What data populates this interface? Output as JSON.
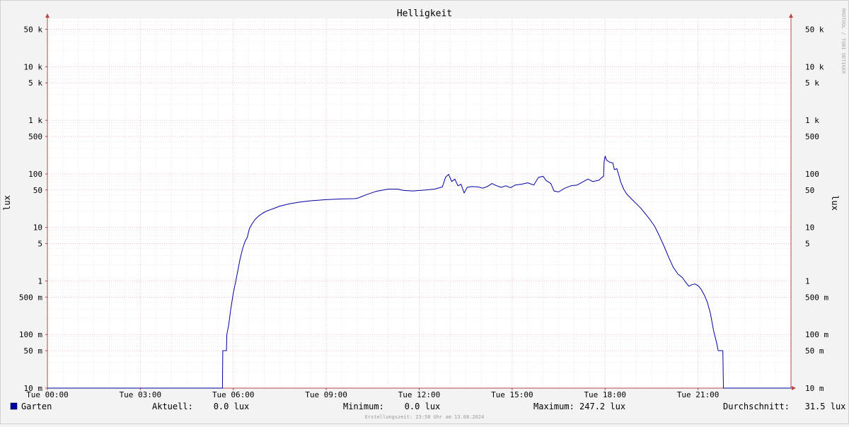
{
  "chart_data": {
    "type": "line",
    "title": "Helligkeit",
    "ylabel": "lux",
    "ylabel_right": "lux",
    "y_scale": "log",
    "ylim": [
      0.01,
      80000
    ],
    "x_range_hours": [
      0,
      24
    ],
    "x_ticks": [
      {
        "label": "Tue 00:00",
        "hour": 0
      },
      {
        "label": "Tue 03:00",
        "hour": 3
      },
      {
        "label": "Tue 06:00",
        "hour": 6
      },
      {
        "label": "Tue 09:00",
        "hour": 9
      },
      {
        "label": "Tue 12:00",
        "hour": 12
      },
      {
        "label": "Tue 15:00",
        "hour": 15
      },
      {
        "label": "Tue 18:00",
        "hour": 18
      },
      {
        "label": "Tue 21:00",
        "hour": 21
      }
    ],
    "y_ticks": [
      {
        "label": "50 k",
        "value": 50000
      },
      {
        "label": "10 k",
        "value": 10000
      },
      {
        "label": "5 k",
        "value": 5000
      },
      {
        "label": "1 k",
        "value": 1000
      },
      {
        "label": "500",
        "value": 500
      },
      {
        "label": "100",
        "value": 100
      },
      {
        "label": "50",
        "value": 50
      },
      {
        "label": "10",
        "value": 10
      },
      {
        "label": "5",
        "value": 5
      },
      {
        "label": "1",
        "value": 1
      },
      {
        "label": "500 m",
        "value": 0.5
      },
      {
        "label": "100 m",
        "value": 0.1
      },
      {
        "label": "50 m",
        "value": 0.05
      },
      {
        "label": "10 m",
        "value": 0.01
      }
    ],
    "series": [
      {
        "name": "Garten",
        "color": "#0000a0",
        "points": [
          [
            0.0,
            0.01
          ],
          [
            5.65,
            0.01
          ],
          [
            5.66,
            0.05
          ],
          [
            5.78,
            0.05
          ],
          [
            5.79,
            0.1
          ],
          [
            5.85,
            0.15
          ],
          [
            5.92,
            0.3
          ],
          [
            6.0,
            0.6
          ],
          [
            6.08,
            1.0
          ],
          [
            6.15,
            1.6
          ],
          [
            6.22,
            2.6
          ],
          [
            6.3,
            4.0
          ],
          [
            6.38,
            5.5
          ],
          [
            6.45,
            6.5
          ],
          [
            6.52,
            9.5
          ],
          [
            6.6,
            11.5
          ],
          [
            6.7,
            14
          ],
          [
            6.8,
            16
          ],
          [
            6.95,
            18.5
          ],
          [
            7.1,
            20.5
          ],
          [
            7.3,
            22.5
          ],
          [
            7.5,
            25
          ],
          [
            7.8,
            27.5
          ],
          [
            8.1,
            29.5
          ],
          [
            8.5,
            31.5
          ],
          [
            9.0,
            33
          ],
          [
            9.5,
            34
          ],
          [
            9.9,
            34.5
          ],
          [
            10.0,
            35
          ],
          [
            10.3,
            41
          ],
          [
            10.6,
            47
          ],
          [
            11.0,
            52
          ],
          [
            11.3,
            52
          ],
          [
            11.5,
            49
          ],
          [
            11.8,
            48
          ],
          [
            12.2,
            50
          ],
          [
            12.5,
            52
          ],
          [
            12.75,
            57
          ],
          [
            12.85,
            86
          ],
          [
            12.95,
            98
          ],
          [
            13.05,
            72
          ],
          [
            13.15,
            80
          ],
          [
            13.25,
            60
          ],
          [
            13.35,
            64
          ],
          [
            13.45,
            44
          ],
          [
            13.55,
            56
          ],
          [
            13.7,
            58
          ],
          [
            13.9,
            57
          ],
          [
            14.05,
            54
          ],
          [
            14.2,
            58
          ],
          [
            14.35,
            66
          ],
          [
            14.5,
            60
          ],
          [
            14.65,
            56
          ],
          [
            14.8,
            60
          ],
          [
            14.95,
            55
          ],
          [
            15.1,
            62
          ],
          [
            15.3,
            64
          ],
          [
            15.5,
            68
          ],
          [
            15.7,
            62
          ],
          [
            15.85,
            86
          ],
          [
            16.0,
            90
          ],
          [
            16.1,
            75
          ],
          [
            16.25,
            66
          ],
          [
            16.35,
            48
          ],
          [
            16.5,
            46
          ],
          [
            16.7,
            54
          ],
          [
            16.9,
            60
          ],
          [
            17.1,
            62
          ],
          [
            17.3,
            72
          ],
          [
            17.45,
            80
          ],
          [
            17.6,
            72
          ],
          [
            17.8,
            76
          ],
          [
            17.9,
            86
          ],
          [
            17.95,
            90
          ],
          [
            17.97,
            170
          ],
          [
            18.0,
            215
          ],
          [
            18.05,
            180
          ],
          [
            18.15,
            165
          ],
          [
            18.25,
            160
          ],
          [
            18.3,
            120
          ],
          [
            18.38,
            125
          ],
          [
            18.45,
            92
          ],
          [
            18.5,
            72
          ],
          [
            18.6,
            52
          ],
          [
            18.7,
            42
          ],
          [
            18.85,
            34
          ],
          [
            19.0,
            28
          ],
          [
            19.15,
            23
          ],
          [
            19.3,
            18
          ],
          [
            19.45,
            14
          ],
          [
            19.6,
            10.5
          ],
          [
            19.75,
            7
          ],
          [
            19.9,
            4.5
          ],
          [
            20.05,
            2.8
          ],
          [
            20.2,
            1.8
          ],
          [
            20.35,
            1.35
          ],
          [
            20.5,
            1.15
          ],
          [
            20.6,
            0.95
          ],
          [
            20.7,
            0.8
          ],
          [
            20.8,
            0.85
          ],
          [
            20.9,
            0.88
          ],
          [
            21.0,
            0.82
          ],
          [
            21.1,
            0.7
          ],
          [
            21.2,
            0.55
          ],
          [
            21.3,
            0.4
          ],
          [
            21.4,
            0.25
          ],
          [
            21.5,
            0.12
          ],
          [
            21.6,
            0.07
          ],
          [
            21.65,
            0.05
          ],
          [
            21.8,
            0.05
          ],
          [
            21.82,
            0.01
          ],
          [
            24.0,
            0.01
          ]
        ]
      }
    ]
  },
  "watermark": "RRDTOOL / TOBI OETIKER",
  "legend": {
    "series_name": "Garten",
    "swatch_color": "#0000a0",
    "aktuell": "Aktuell:    0.0 lux",
    "minimum": "Minimum:    0.0 lux",
    "maximum": "Maximum: 247.2 lux",
    "durchschnitt": "Durchschnitt:   31.5 lux"
  },
  "footer": "Erstellungszeit: 23:58 Uhr am 13.08.2024"
}
